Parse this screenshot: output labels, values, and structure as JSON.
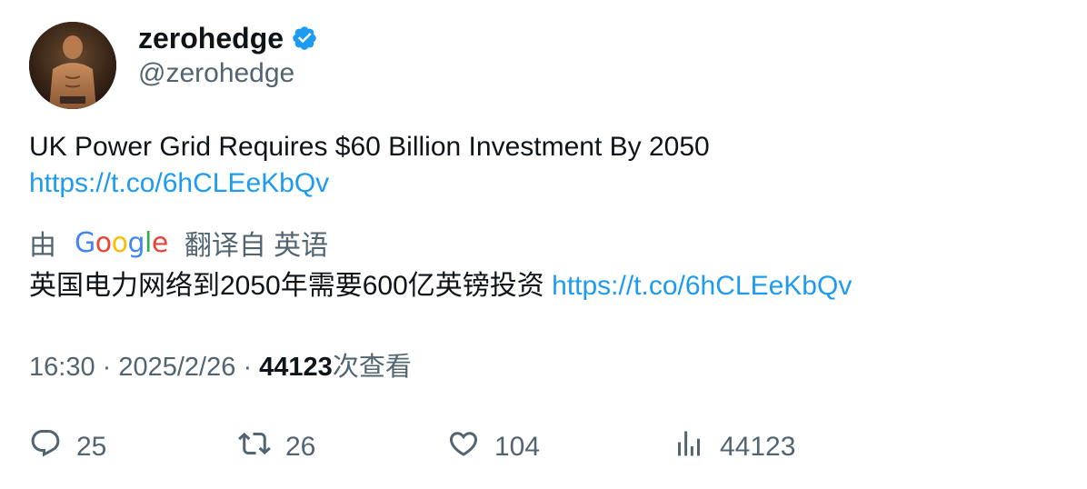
{
  "author": {
    "display_name": "zerohedge",
    "handle": "@zerohedge",
    "verified": true,
    "verified_color": "#1d9bf0"
  },
  "tweet": {
    "text": "UK Power Grid Requires $60 Billion Investment By 2050",
    "link": "https://t.co/6hCLEeKbQv"
  },
  "translation": {
    "prefix": "由",
    "provider_letters": [
      "G",
      "o",
      "o",
      "g",
      "l",
      "e"
    ],
    "suffix": "翻译自 英语",
    "text": "英国电力网络到2050年需要600亿英镑投资",
    "link": "https://t.co/6hCLEeKbQv"
  },
  "meta": {
    "time": "16:30",
    "separator": "·",
    "date": "2025/2/26",
    "views_count": "44123",
    "views_label": "次查看"
  },
  "actions": {
    "replies": "25",
    "retweets": "26",
    "likes": "104",
    "views": "44123"
  },
  "colors": {
    "link": "#1d9bf0",
    "secondary_text": "#536471",
    "primary_text": "#0f1419"
  }
}
